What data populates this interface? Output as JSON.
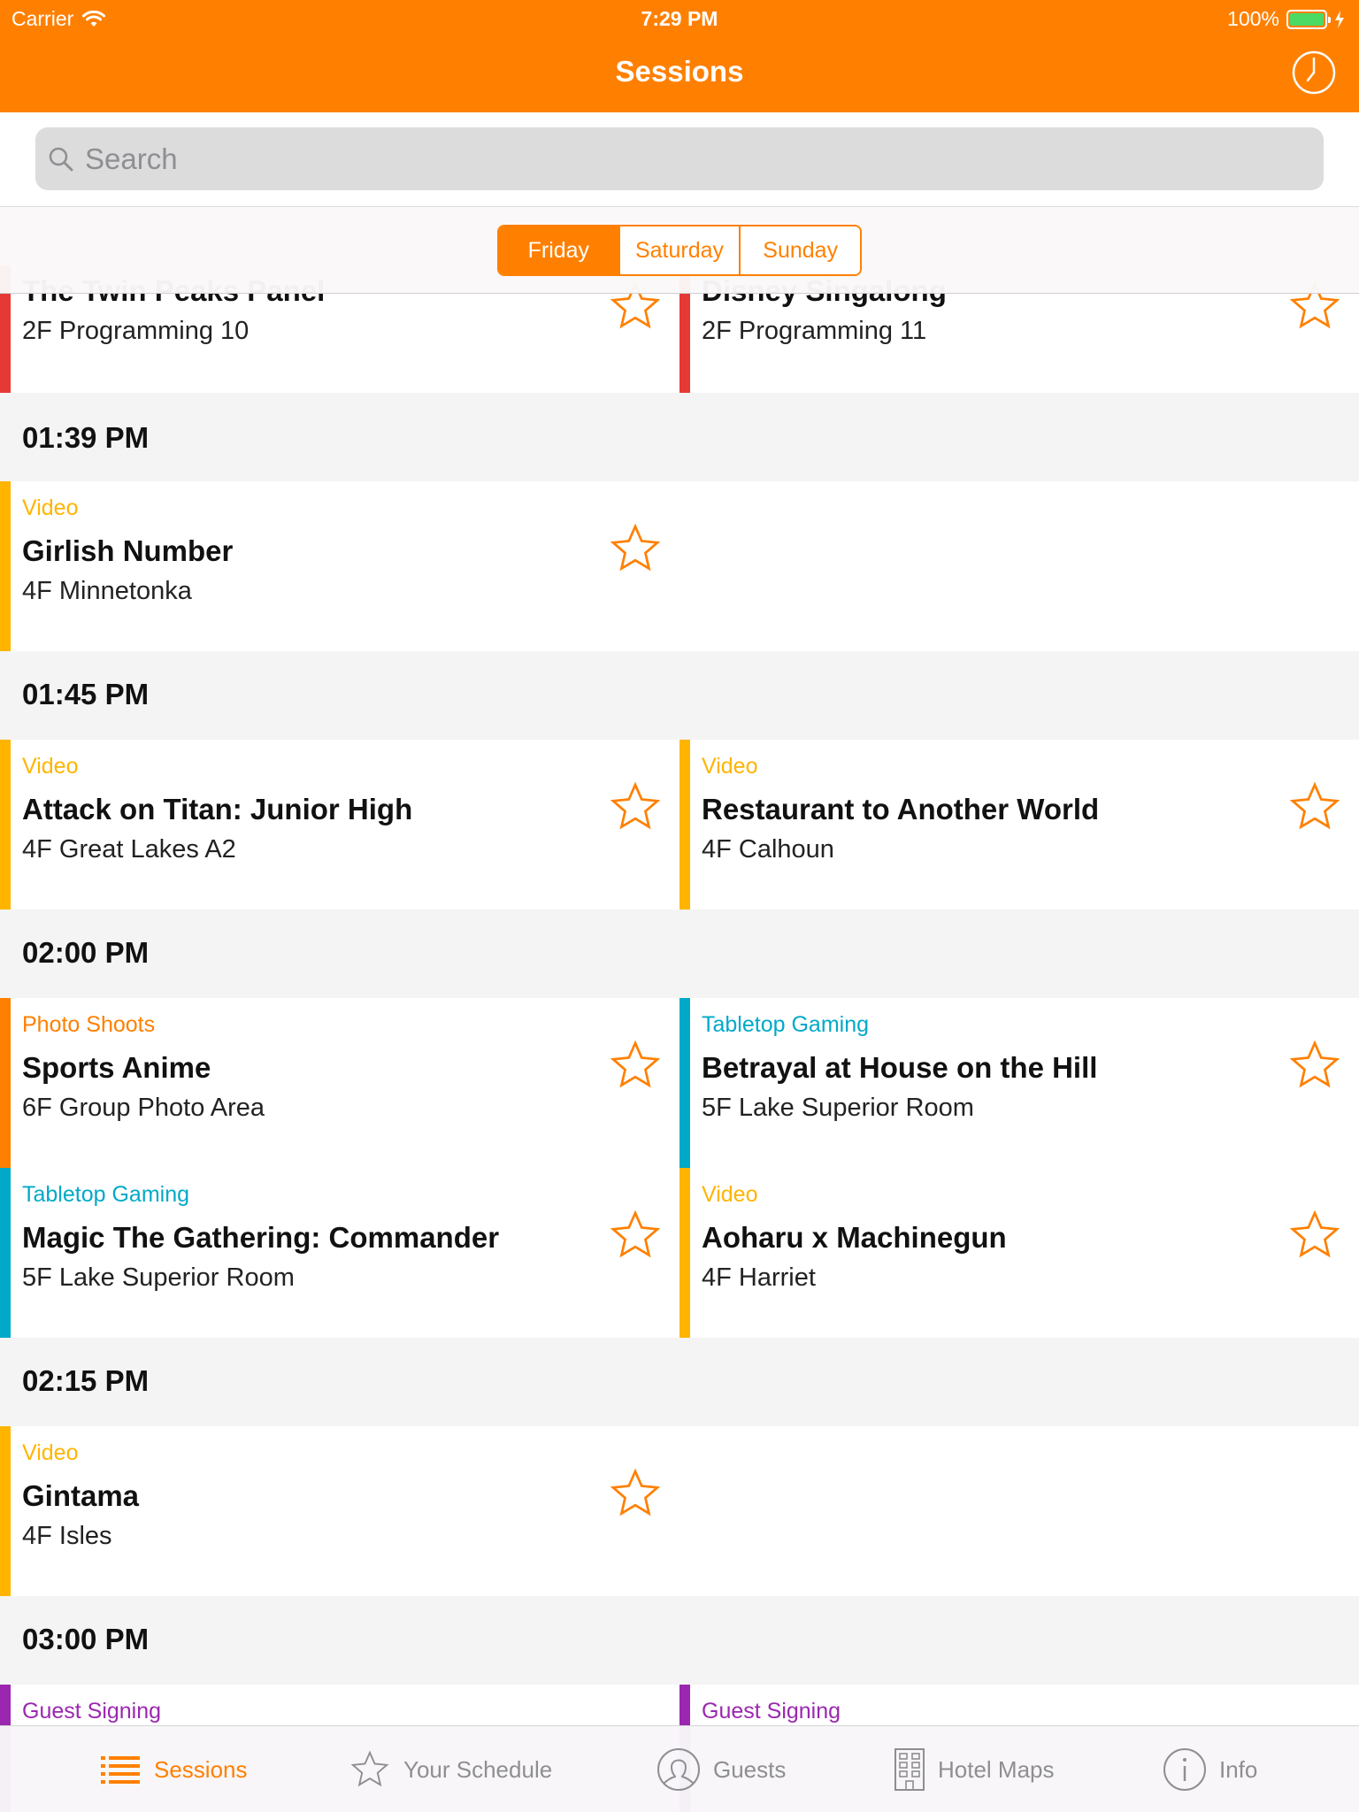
{
  "status_bar": {
    "carrier": "Carrier",
    "time": "7:29 PM",
    "battery": "100%"
  },
  "nav": {
    "title": "Sessions"
  },
  "search": {
    "placeholder": "Search"
  },
  "days": [
    "Friday",
    "Saturday",
    "Sunday"
  ],
  "selected_day": "Friday",
  "top_cells": [
    {
      "title": "The Twin Peaks Panel",
      "room": "2F Programming 10"
    },
    {
      "title": "Disney Singalong",
      "room": "2F Programming 11"
    }
  ],
  "sections": [
    {
      "time": "01:39 PM",
      "sessions": [
        {
          "category": "Video",
          "title": "Girlish Number",
          "room": "4F Minnetonka"
        }
      ]
    },
    {
      "time": "01:45 PM",
      "sessions": [
        {
          "category": "Video",
          "title": "Attack on Titan: Junior High",
          "room": "4F Great Lakes A2"
        },
        {
          "category": "Video",
          "title": "Restaurant to Another World",
          "room": "4F Calhoun"
        }
      ]
    },
    {
      "time": "02:00 PM",
      "sessions": [
        {
          "category": "Photo Shoots",
          "title": "Sports Anime",
          "room": "6F Group Photo Area"
        },
        {
          "category": "Tabletop Gaming",
          "title": "Betrayal at House on the Hill",
          "room": "5F Lake Superior Room"
        },
        {
          "category": "Tabletop Gaming",
          "title": "Magic The Gathering: Commander",
          "room": "5F Lake Superior Room"
        },
        {
          "category": "Video",
          "title": "Aoharu x Machinegun",
          "room": "4F Harriet"
        }
      ]
    },
    {
      "time": "02:15 PM",
      "sessions": [
        {
          "category": "Video",
          "title": "Gintama",
          "room": "4F Isles"
        }
      ]
    },
    {
      "time": "03:00 PM",
      "sessions": [
        {
          "category": "Guest Signing"
        },
        {
          "category": "Guest Signing"
        }
      ]
    }
  ],
  "category_colors": {
    "Video": "#ffb400",
    "Photo Shoots": "#ff7f00",
    "Tabletop Gaming": "#00a9c8",
    "Guest Signing": "#9b27b0",
    "Programming": "#e53935"
  },
  "tabs": [
    {
      "label": "Sessions",
      "icon": "list-icon",
      "active": true
    },
    {
      "label": "Your Schedule",
      "icon": "star-icon",
      "active": false
    },
    {
      "label": "Guests",
      "icon": "person-icon",
      "active": false
    },
    {
      "label": "Hotel Maps",
      "icon": "building-icon",
      "active": false
    },
    {
      "label": "Info",
      "icon": "info-icon",
      "active": false
    }
  ],
  "accent_color": "#ff8000"
}
